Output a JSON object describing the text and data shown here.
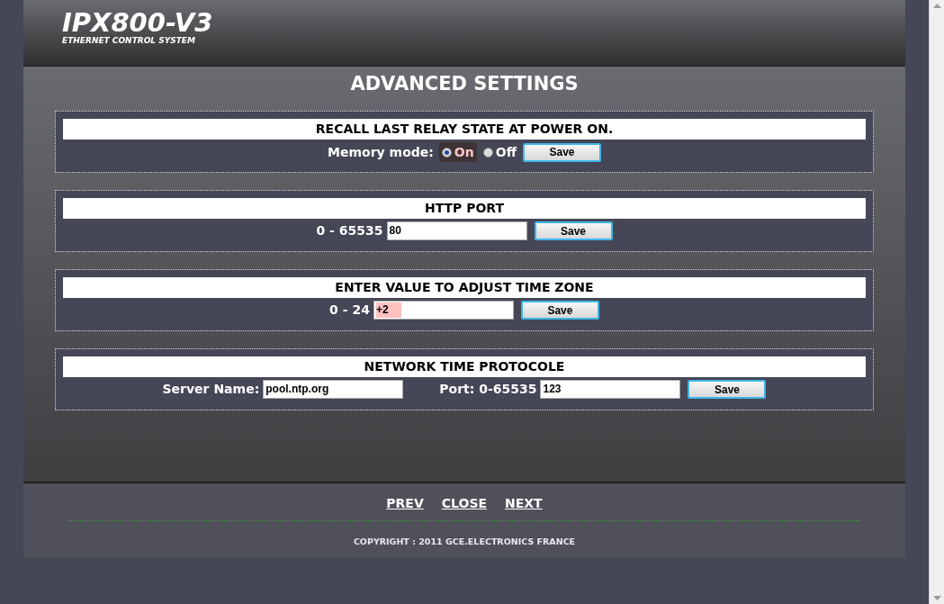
{
  "header": {
    "logo": "IPX800-V3",
    "tagline": "ETHERNET CONTROL SYSTEM"
  },
  "page_title": "ADVANCED SETTINGS",
  "sections": [
    {
      "kind": "radio",
      "title": "RECALL LAST RELAY STATE AT POWER ON.",
      "label": "Memory mode:",
      "options": [
        {
          "label": "On",
          "selected": true
        },
        {
          "label": "Off",
          "selected": false
        }
      ],
      "button": "Save"
    },
    {
      "kind": "field",
      "title": "HTTP PORT",
      "label": "0 - 65535",
      "value": "80",
      "highlighted": false,
      "button": "Save"
    },
    {
      "kind": "field",
      "title": "ENTER VALUE TO ADJUST TIME ZONE",
      "label": "0 - 24",
      "value": "+2",
      "highlighted": true,
      "button": "Save"
    },
    {
      "kind": "ntp",
      "title": "NETWORK TIME PROTOCOLE",
      "server_label": "Server Name:",
      "server_value": "pool.ntp.org",
      "port_label": "Port: 0-65535",
      "port_value": "123",
      "button": "Save"
    }
  ],
  "footer": {
    "links": [
      "PREV",
      "CLOSE",
      "NEXT"
    ],
    "copyright": "COPYRIGHT : 2011 GCE.ELECTRONICS FRANCE"
  }
}
